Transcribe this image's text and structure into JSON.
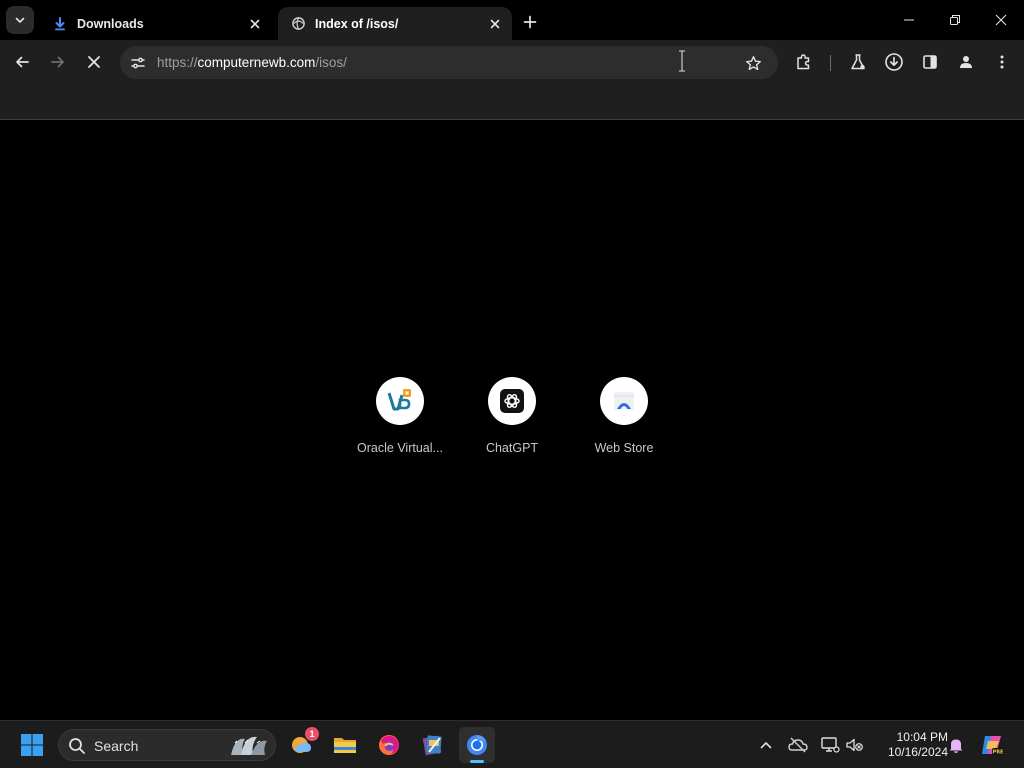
{
  "browser": {
    "tabs": [
      {
        "title": "Downloads",
        "active": false,
        "favicon": "download-icon"
      },
      {
        "title": "Index of /isos/",
        "active": true,
        "favicon": "loading-globe-icon"
      }
    ],
    "address": {
      "scheme": "https://",
      "host": "computernewb.com",
      "path": "/isos/"
    }
  },
  "shortcuts": [
    {
      "label": "Oracle Virtual...",
      "icon": "virtualbox-icon"
    },
    {
      "label": "ChatGPT",
      "icon": "chatgpt-icon"
    },
    {
      "label": "Web Store",
      "icon": "web-store-icon"
    }
  ],
  "taskbar": {
    "search_placeholder": "Search",
    "notification_count": "1",
    "time": "10:04 PM",
    "date": "10/16/2024"
  },
  "colors": {
    "accent": "#4cc2ff",
    "tab_active": "#1f1f1f",
    "omnibox": "#2d2d2d",
    "page_bg": "#000000"
  }
}
